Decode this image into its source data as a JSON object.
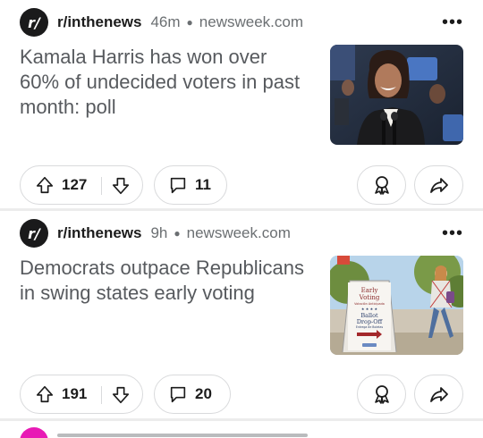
{
  "posts": [
    {
      "subreddit": "r/inthenews",
      "time": "46m",
      "domain": "newsweek.com",
      "title": "Kamala Harris has won over 60% of undecided voters in past month: poll",
      "thumbnail": "photo-woman-smiling-at-podium",
      "upvotes": "127",
      "comments": "11"
    },
    {
      "subreddit": "r/inthenews",
      "time": "9h",
      "domain": "newsweek.com",
      "title": "Democrats outpace Republicans in swing states early voting",
      "thumbnail": "photo-early-voting-sign",
      "sign_lines": [
        "Early",
        "Voting",
        "Votación Anticipada",
        "★ ★ ★ ★",
        "Ballot",
        "Drop-Off",
        "Entrega de Boletas"
      ],
      "upvotes": "191",
      "comments": "20"
    }
  ],
  "icons": {
    "subreddit_avatar": "r-slash-logo",
    "more": "more-horizontal-icon",
    "upvote": "arrow-up-icon",
    "downvote": "arrow-down-icon",
    "comment": "comment-bubble-icon",
    "award": "award-ribbon-icon",
    "share": "share-arrow-icon"
  },
  "colors": {
    "title": "#575a5e",
    "meta": "#6b6f72",
    "border": "#d9dadc",
    "avatar_bg": "#1a1a1b",
    "next_avatar": "#e81ab5"
  }
}
